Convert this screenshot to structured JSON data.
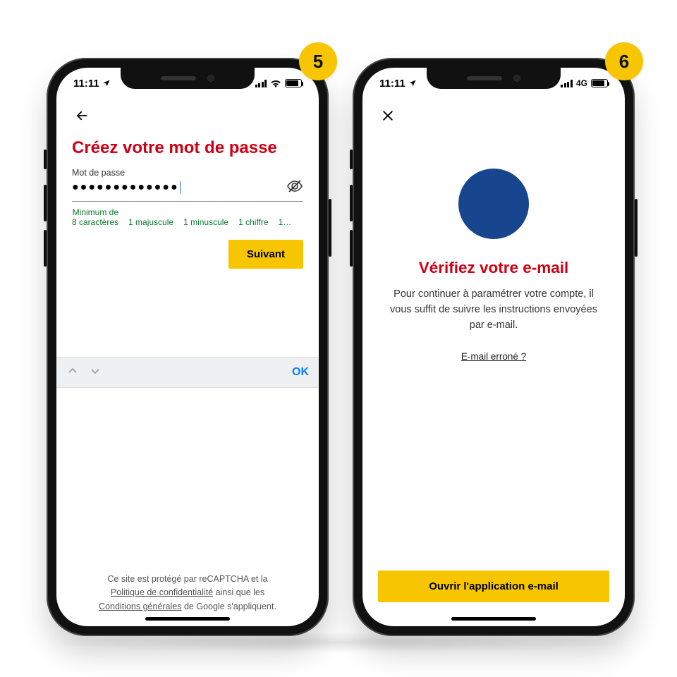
{
  "colors": {
    "accent": "#F7C600",
    "heading": "#D00014",
    "rule_ok": "#0a7a2e",
    "circle": "#17468f"
  },
  "screen5": {
    "step": "5",
    "status": {
      "time": "11:11",
      "network_type": "wifi"
    },
    "title": "Créez votre mot de passe",
    "password": {
      "label": "Mot de passe",
      "masked_value": "●●●●●●●●●●●●●",
      "rules_lead_line1": "Minimum de",
      "rules_lead_line2": "8 caractères",
      "rules": [
        "1 majuscule",
        "1 minuscule",
        "1 chiffre",
        "1…"
      ]
    },
    "next_button": "Suivant",
    "keyboard_accessory": {
      "ok": "OK"
    },
    "footer": {
      "line1_a": "Ce site est protégé par reCAPTCHA et la",
      "line2_link": "Politique de confidentialité",
      "line2_b": " ainsi que les",
      "line3_link": "Conditions générales",
      "line3_b": " de Google s'appliquent."
    }
  },
  "screen6": {
    "step": "6",
    "status": {
      "time": "11:11",
      "network_label": "4G"
    },
    "title": "Vérifiez votre e-mail",
    "body": "Pour continuer à paramétrer votre compte, il vous suffit de suivre les instructions envoyées par e-mail.",
    "wrong_email": "E-mail erroné ?",
    "open_mail_button": "Ouvrir l'application e-mail"
  }
}
